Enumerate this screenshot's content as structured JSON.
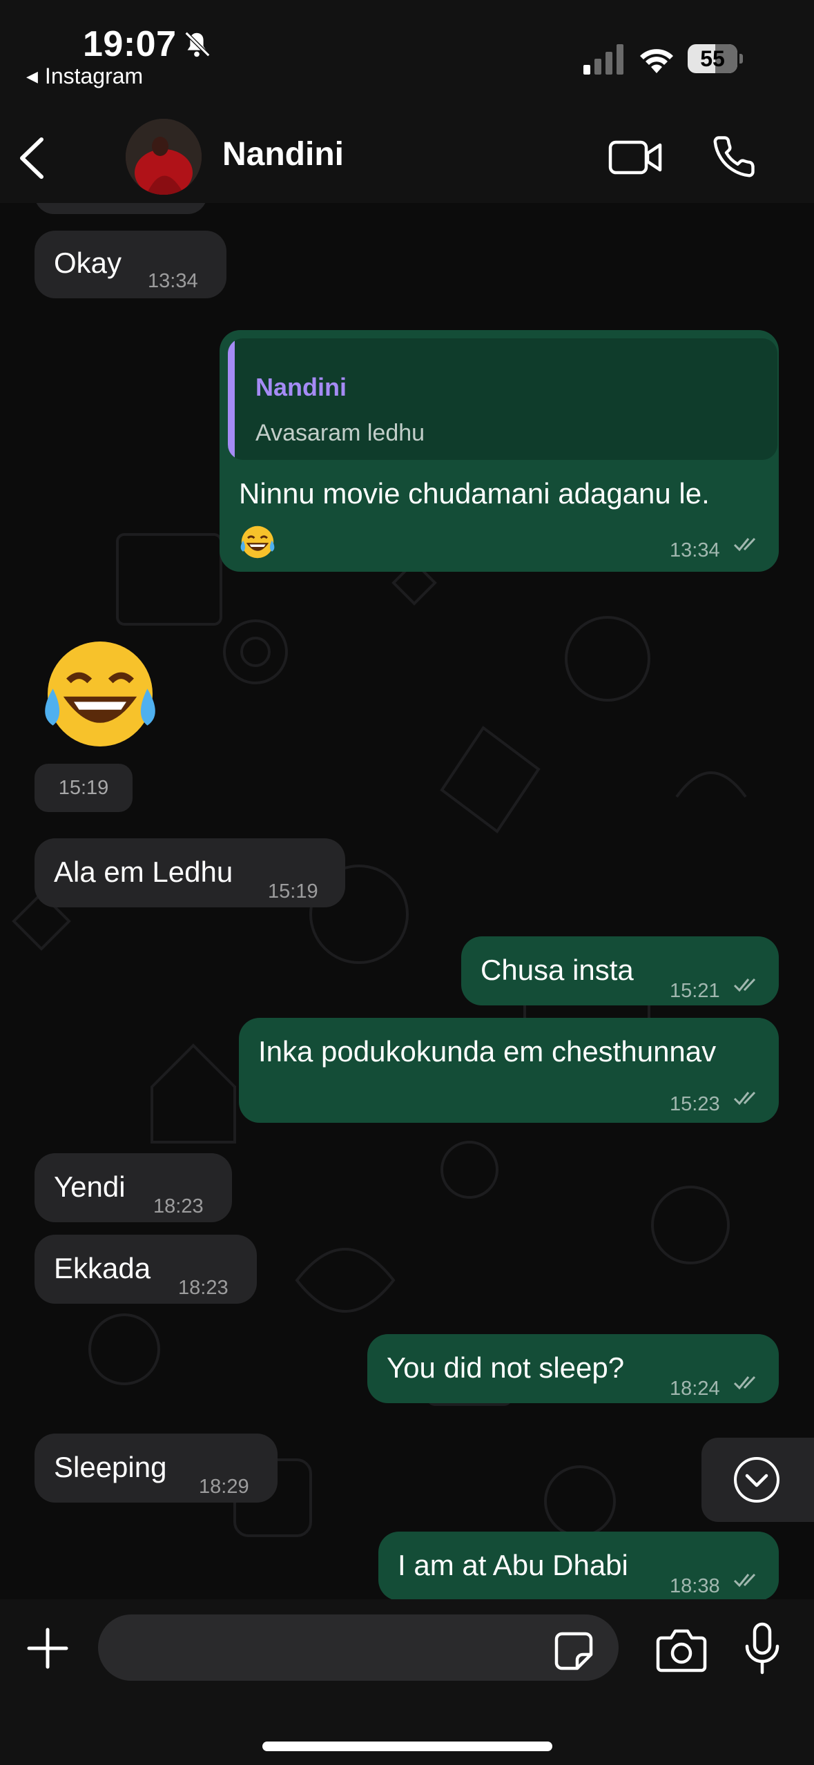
{
  "status_bar": {
    "time": "19:07",
    "back_app": "Instagram",
    "battery": "55",
    "icons": [
      "bell-slash-icon",
      "signal-icon",
      "wifi-icon",
      "battery-icon"
    ]
  },
  "header": {
    "contact_name": "Nandini",
    "icons": [
      "chevron-left-icon",
      "video-camera-icon",
      "phone-icon"
    ]
  },
  "messages": [
    {
      "dir": "in",
      "text": "Okay",
      "time": "13:34"
    },
    {
      "dir": "out",
      "reply_to_name": "Nandini",
      "reply_to_text": "Avasaram ledhu",
      "text": "Ninnu movie chudamani adaganu le.",
      "emoji": "😂",
      "time": "13:34"
    },
    {
      "dir": "in",
      "emoji": "😂",
      "time": "15:19"
    },
    {
      "dir": "in",
      "text": "Ala em Ledhu",
      "time": "15:19"
    },
    {
      "dir": "out",
      "text": "Chusa insta",
      "time": "15:21"
    },
    {
      "dir": "out",
      "text": "Inka podukokunda em chesthunnav",
      "time": "15:23"
    },
    {
      "dir": "in",
      "text": "Yendi",
      "time": "18:23"
    },
    {
      "dir": "in",
      "text": "Ekkada",
      "time": "18:23"
    },
    {
      "dir": "out",
      "text": "You did not sleep?",
      "time": "18:24"
    },
    {
      "dir": "in",
      "text": "Sleeping",
      "time": "18:29"
    },
    {
      "dir": "out",
      "text": "I am at Abu Dhabi",
      "time": "18:38"
    }
  ],
  "input_bar": {
    "placeholder": "",
    "icons": [
      "plus-icon",
      "sticker-icon",
      "camera-icon",
      "microphone-icon"
    ]
  },
  "colors": {
    "incoming_bubble": "#252527",
    "outgoing_bubble": "#144d37",
    "reply_accent": "#a58bf5",
    "background": "#0c0c0c"
  }
}
